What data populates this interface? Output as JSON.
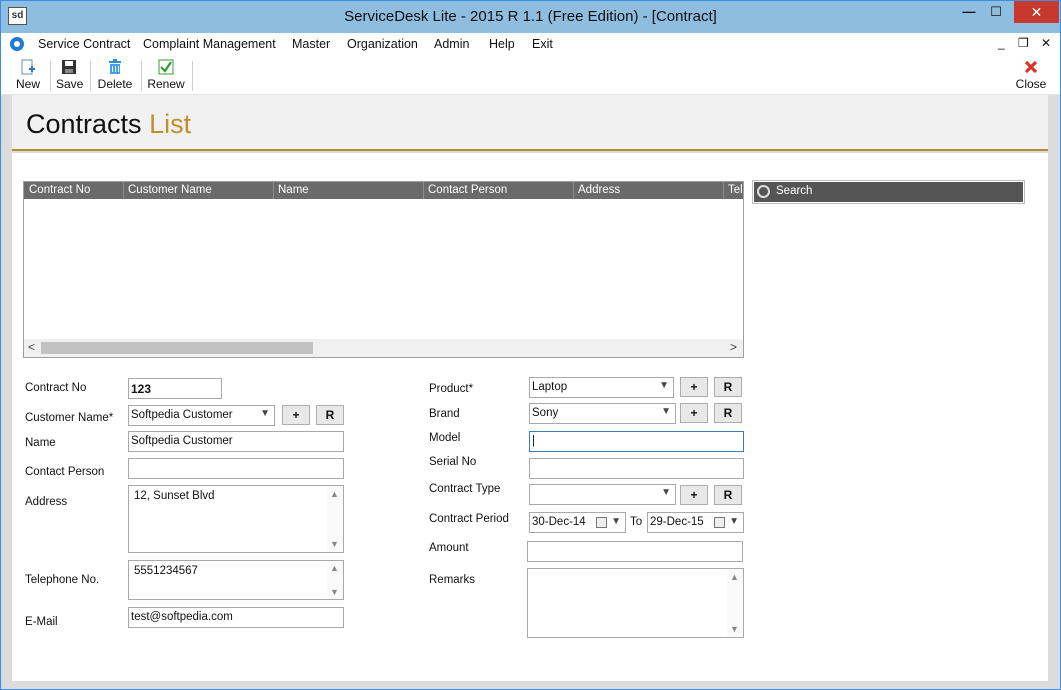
{
  "window": {
    "app_icon": "sd",
    "title": "ServiceDesk Lite - 2015 R 1.1 (Free Edition) - [Contract]",
    "min_icon": "minimize-icon",
    "max_icon": "maximize-icon",
    "close_icon": "window-close-icon"
  },
  "menu": {
    "items": [
      "Service Contract",
      "Complaint Management",
      "Master",
      "Organization",
      "Admin",
      "Help",
      "Exit"
    ],
    "mdi_min": "_",
    "mdi_restore": "❐",
    "mdi_close": "✕"
  },
  "toolbar": {
    "new_label": "New",
    "save_label": "Save",
    "delete_label": "Delete",
    "renew_label": "Renew",
    "close_label": "Close"
  },
  "header": {
    "title": "Contracts",
    "subtitle": "List"
  },
  "grid": {
    "columns": [
      "Contract No",
      "Customer Name",
      "Name",
      "Contact Person",
      "Address",
      "Tel"
    ],
    "left_arrow": "<",
    "right_arrow": ">"
  },
  "search": {
    "label": "Search"
  },
  "form": {
    "contract_no_label": "Contract No",
    "contract_no": "123",
    "customer_name_label": "Customer Name*",
    "customer_name": "Softpedia Customer",
    "name_label": "Name",
    "name": "Softpedia Customer",
    "contact_person_label": "Contact Person",
    "contact_person": "",
    "address_label": "Address",
    "address": "12, Sunset Blvd",
    "telephone_label": "Telephone No.",
    "telephone": "5551234567",
    "email_label": "E-Mail",
    "email": "test@softpedia.com",
    "product_label": "Product*",
    "product": "Laptop",
    "brand_label": "Brand",
    "brand": "Sony",
    "model_label": "Model",
    "model": "|",
    "serial_label": "Serial No",
    "serial": "",
    "contract_type_label": "Contract Type",
    "contract_type": "",
    "contract_period_label": "Contract Period",
    "period_from": "30-Dec-14",
    "to_label": "To",
    "period_to": "29-Dec-15",
    "amount_label": "Amount",
    "amount": "",
    "remarks_label": "Remarks",
    "remarks": "",
    "add_button": "+",
    "refresh_button": "R"
  }
}
